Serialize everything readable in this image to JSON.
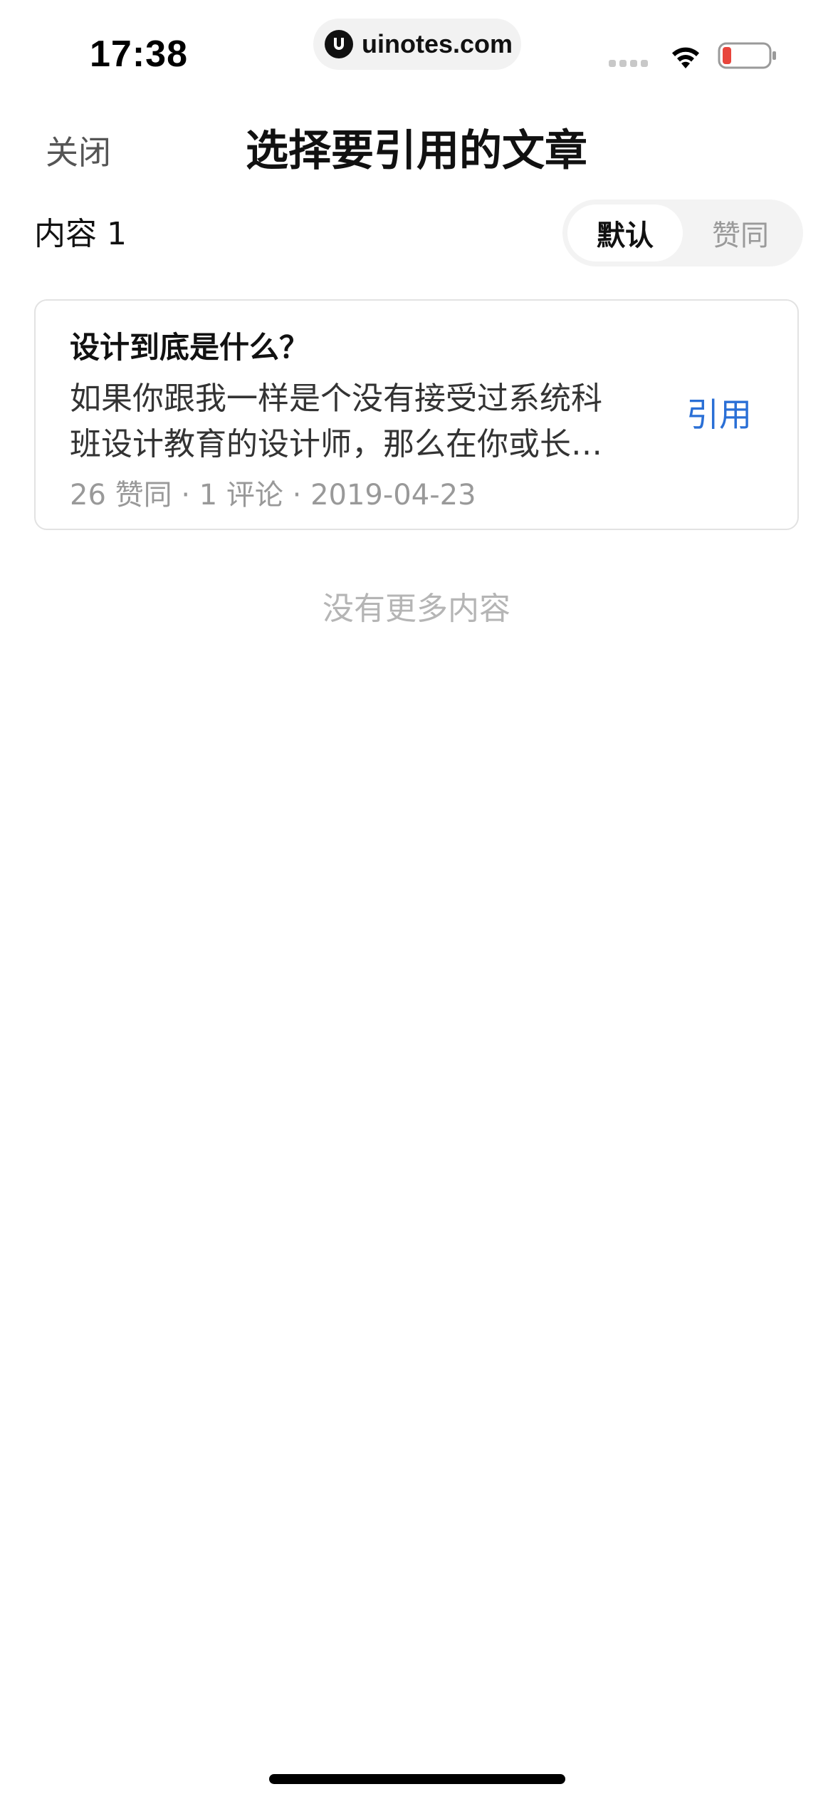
{
  "status_bar": {
    "time": "17:38",
    "url": "uinotes.com",
    "icons": {
      "signal": "cellular-signal-icon",
      "wifi": "wifi-icon",
      "battery": "battery-low-icon"
    },
    "battery_color": "#e8453c"
  },
  "nav": {
    "close_label": "关闭",
    "title": "选择要引用的文章"
  },
  "content_header": {
    "count_label": "内容 1",
    "sort_options": [
      "默认",
      "赞同"
    ],
    "selected_sort": "默认"
  },
  "articles": [
    {
      "title": "设计到底是什么？",
      "excerpt": "如果你跟我一样是个没有接受过系统科班设计教育的设计师，那么在你或长…",
      "meta": "26 赞同 · 1 评论 · 2019-04-23",
      "action_label": "引用"
    }
  ],
  "footer": {
    "no_more_text": "没有更多内容"
  },
  "colors": {
    "accent": "#2a6fd6",
    "muted_text": "#999999",
    "segmented_bg": "#f3f3f3"
  }
}
